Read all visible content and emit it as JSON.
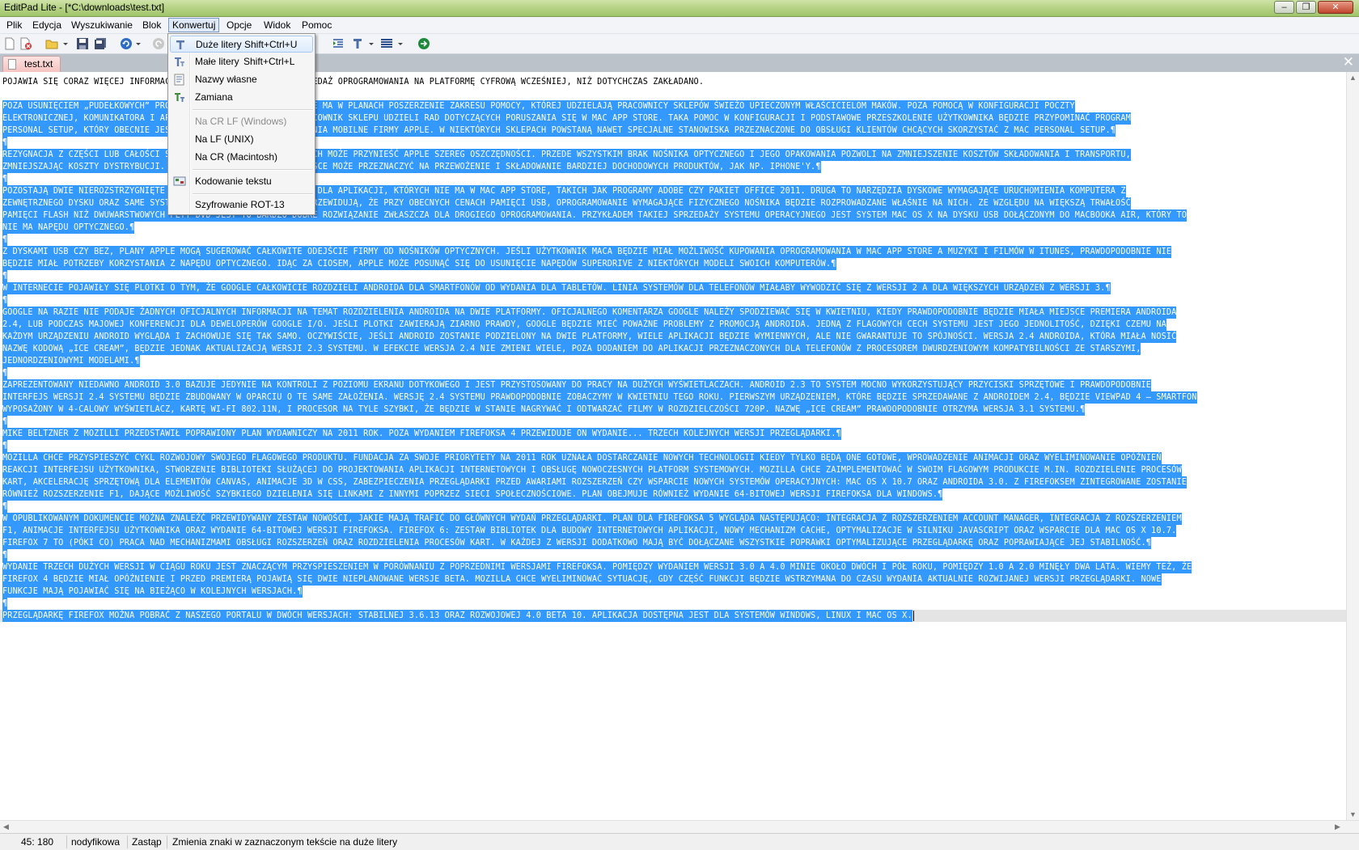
{
  "window": {
    "title": "EditPad Lite - [*C:\\downloads\\test.txt]",
    "minimize": "–",
    "restore": "❐",
    "close": "✕"
  },
  "menubar": [
    "Plik",
    "Edycja",
    "Wyszukiwanie",
    "Blok",
    "Konwertuj",
    "Opcje",
    "Widok",
    "Pomoc"
  ],
  "menubar_active": "Konwertuj",
  "toolbar_icons": [
    "new-file-icon",
    "close-file-icon",
    "open-icon",
    "save-icon",
    "save-all-icon",
    "undo-icon",
    "redo-icon",
    "indent-icon",
    "font-icon",
    "block-icon",
    "web-icon"
  ],
  "tab": {
    "label": "test.txt",
    "close": "✕"
  },
  "dropdown": {
    "items": [
      {
        "label": "Duże litery",
        "shortcut": "Shift+Ctrl+U",
        "icon": "uppercase-icon",
        "highlighted": true,
        "disabled": false
      },
      {
        "label": "Małe litery",
        "shortcut": "Shift+Ctrl+L",
        "icon": "lowercase-icon",
        "highlighted": false,
        "disabled": false
      },
      {
        "label": "Nazwy własne",
        "shortcut": "",
        "icon": "propercase-icon",
        "highlighted": false,
        "disabled": false
      },
      {
        "label": "Zamiana",
        "shortcut": "",
        "icon": "swapcase-icon",
        "highlighted": false,
        "disabled": false
      },
      {
        "label": "Na CR LF (Windows)",
        "shortcut": "",
        "icon": "",
        "highlighted": false,
        "disabled": true
      },
      {
        "label": "Na LF (UNIX)",
        "shortcut": "",
        "icon": "",
        "highlighted": false,
        "disabled": false
      },
      {
        "label": "Na CR (Macintosh)",
        "shortcut": "",
        "icon": "",
        "highlighted": false,
        "disabled": false
      },
      {
        "label": "Kodowanie tekstu",
        "shortcut": "",
        "icon": "encoding-icon",
        "highlighted": false,
        "disabled": false
      },
      {
        "label": "Szyfrowanie ROT-13",
        "shortcut": "",
        "icon": "",
        "highlighted": false,
        "disabled": false
      }
    ]
  },
  "editor": {
    "lines": [
      {
        "text": "POJAWIA SIĘ CORAZ WIĘCEJ INFORMACJI, ŻE APPLE PRZENIESIE SPRZEDAŻ OPROGRAMOWANIA NA PLATFORMĘ CYFROWĄ WCZEŚNIEJ, NIŻ DOTYCHCZAS ZAKŁADANO.",
        "sel": false,
        "pm": false
      },
      {
        "text": "",
        "sel": false,
        "pm": false
      },
      {
        "text": "POZA USUNIĘCIEM „PUDEŁKOWYCH” PROGRAMÓW Z PÓŁEK SKLEPÓW, APPLE MA W PLANACH POSZERZENIE ZAKRESU POMOCY, KTÓREJ UDZIELAJĄ PRACOWNICY SKLEPÓW ŚWIEŻO UPIECZONYM WŁAŚCICIELOM MAKÓW. POZA POMOCĄ W KONFIGURACJI POCZTY",
        "sel": true,
        "pm": false
      },
      {
        "text": "ELEKTRONICZNEJ, KOMUNIKATORA I APLIKACJI Z MAC APP STORE, PRACOWNIK SKLEPU UDZIELI RAD DOTYCZĄCYCH PORUSZANIA SIĘ W MAC APP STORE. TAKA POMOC W KONFIGURACJI I PODSTAWOWE PRZESZKOLENIE UŻYTKOWNIKA BĘDZIE PRZYPOMINAĆ PROGRAM",
        "sel": true,
        "pm": false
      },
      {
        "text": "PERSONAL SETUP, KTÓRY OBECNIE JEST DOSTĘPNY KUPUJĄCYM URZĄDZENIA MOBILNE FIRMY APPLE. W NIEKTÓRYCH SKLEPACH POWSTANĄ NAWET SPECJALNE STANOWISKA PRZEZNACZONE DO OBSŁUGI KLIENTÓW CHCĄCYCH SKORZYSTAĆ Z MAC PERSONAL SETUP.",
        "sel": true,
        "pm": true
      },
      {
        "text": "",
        "sel": true,
        "pm": true
      },
      {
        "text": "REZYGNACJA Z CZĘŚCI LUB CAŁOŚCI SPRZEDAŻY PUDEŁKOWEJ W SKLEPACH MOŻE PRZYNIEŚĆ APPLE SZEREG OSZCZĘDNOŚCI. PRZEDE WSZYSTKIM BRAK NOŚNIKA OPTYCZNEGO I JEGO OPAKOWANIA POZWOLI NA ZMNIEJSZENIE KOSZTÓW SKŁADOWANIA I TRANSPORTU,",
        "sel": true,
        "pm": false
      },
      {
        "text": "ZMNIEJSZAJĄC KOSZTY DYSTRYBUCJI. DODATKOWO ZAOSZCZĘDZONE MIEJSCE MOŻE PRZEZNACZYĆ NA PRZEWOŻENIE I SKŁADOWANIE BARDZIEJ DOCHODOWYCH PRODUKTÓW, JAK NP. IPHONE'Y.",
        "sel": true,
        "pm": true
      },
      {
        "text": "",
        "sel": true,
        "pm": true
      },
      {
        "text": "POZOSTAJĄ DWIE NIEROZSTRZYGNIĘTE KWESTIE. PIERWSZA TO MIEJSCE DLA APLIKACJI, KTÓRYCH NIE MA W MAC APP STORE, TAKICH JAK PROGRAMY ADOBE CZY PAKIET OFFICE 2011. DRUGA TO NARZĘDZIA DYSKOWE WYMAGAJĄCE URUCHOMIENIA KOMPUTERA Z",
        "sel": true,
        "pm": false
      },
      {
        "text": "ZEWNĘTRZNEGO DYSKU ORAZ SAME SYSTEMY FIRMY APPLE. ANALITYCY PRZEWIDUJĄ, ŻE PRZY OBECNYCH CENACH PAMIĘCI USB, OPROGRAMOWANIE WYMAGAJĄCE FIZYCZNEGO NOŚNIKA BĘDZIE ROZPROWADZANE WŁAŚNIE NA NICH. ZE WZGLĘDU NA WIĘKSZĄ TRWAŁOŚĆ",
        "sel": true,
        "pm": false
      },
      {
        "text": "PAMIĘCI FLASH NIŻ DWUWARSTWOWYCH PŁYT DVD JEST TO BARDZO DOBRE ROZWIĄZANIE ZWŁASZCZA DLA DROGIEGO OPROGRAMOWANIA. PRZYKŁADEM TAKIEJ SPRZEDAŻY SYSTEMU OPERACYJNEGO JEST SYSTEM MAC OS X NA DYSKU USB DOŁĄCZONYM DO MACBOOKA AIR, KTÓRY TO",
        "sel": true,
        "pm": false
      },
      {
        "text": "NIE MA NAPĘDU OPTYCZNEGO.",
        "sel": true,
        "pm": true
      },
      {
        "text": "",
        "sel": true,
        "pm": true
      },
      {
        "text": "Z DYSKAMI USB CZY BEZ, PLANY APPLE MOGĄ SUGEROWAĆ CAŁKOWITE ODEJŚCIE FIRMY OD NOŚNIKÓW OPTYCZNYCH. JEŚLI UŻYTKOWNIK MACA BĘDZIE MIAŁ MOŻLIWOŚĆ KUPOWANIA OPROGRAMOWANIA W MAC APP STORE A MUZYKI I FILMÓW W ITUNES, PRAWDOPODOBNIE NIE",
        "sel": true,
        "pm": false
      },
      {
        "text": "BĘDZIE MIAŁ POTRZEBY KORZYSTANIA Z NAPĘDU OPTYCZNEGO. IDĄC ZA CIOSEM, APPLE MOŻE POSUNĄĆ SIĘ DO USUNIĘCIE NAPĘDÓW SUPERDRIVE Z NIEKTÓRYCH MODELI SWOICH KOMPUTERÓW.",
        "sel": true,
        "pm": true
      },
      {
        "text": "",
        "sel": true,
        "pm": true
      },
      {
        "text": "W INTERNECIE POJAWIŁY SIĘ PLOTKI O TYM, ŻE GOOGLE CAŁKOWICIE ROZDZIELI ANDROIDA DLA SMARTFONÓW OD WYDANIA DLA TABLETÓW. LINIA SYSTEMÓW DLA TELEFONÓW MIAŁABY WYWODZIĆ SIĘ Z WERSJI 2 A DLA WIĘKSZYCH URZĄDZEŃ Z WERSJI 3.",
        "sel": true,
        "pm": true
      },
      {
        "text": "",
        "sel": true,
        "pm": true
      },
      {
        "text": "GOOGLE NA RAZIE NIE PODAJE ŻADNYCH OFICJALNYCH INFORMACJI NA TEMAT ROZDZIELENIA ANDROIDA NA DWIE PLATFORMY. OFICJALNEGO KOMENTARZA GOOGLE NALEŻY SPODZIEWAĆ SIĘ W KWIETNIU, KIEDY PRAWDOPODOBNIE BĘDZIE MIAŁA MIEJSCE PREMIERA ANDROIDA",
        "sel": true,
        "pm": false
      },
      {
        "text": "2.4, LUB PODCZAS MAJOWEJ KONFERENCJI DLA DEWELOPERÓW GOOGLE I/O. JEŚLI PLOTKI ZAWIERAJĄ ZIARNO PRAWDY, GOOGLE BĘDZIE MIEĆ POWAŻNE PROBLEMY Z PROMOCJĄ ANDROIDA. JEDNĄ Z FLAGOWYCH CECH SYSTEMU JEST JEGO JEDNOLITOŚĆ, DZIĘKI CZEMU NA",
        "sel": true,
        "pm": false
      },
      {
        "text": "KAŻDYM URZĄDZENIU ANDROID WYGLĄDA I ZACHOWUJE SIĘ TAK SAMO. OCZYWIŚCIE, JEŚLI ANDROID ZOSTANIE PODZIELONY NA DWIE PLATFORMY, WIELE APLIKACJI BĘDZIE WYMIENNYCH, ALE NIE GWARANTUJE TO SPÓJNOŚCI. WERSJA 2.4 ANDROIDA, KTÓRA MIAŁA NOSIĆ",
        "sel": true,
        "pm": false
      },
      {
        "text": "NAZWĘ KODOWĄ „ICE CREAM”, BĘDZIE JEDNAK AKTUALIZACJĄ WERSJI 2.3 SYSTEMU. W EFEKCIE WERSJA 2.4 NIE ZMIENI WIELE, POZA DODANIEM DO APLIKACJI PRZEZNACZONYCH DLA TELEFONÓW Z PROCESOREM DWURDZENIOWYM KOMPATYBILNOŚCI ZE STARSZYMI,",
        "sel": true,
        "pm": false
      },
      {
        "text": "JEDNORDZENIOWYMI MODELAMI.",
        "sel": true,
        "pm": true
      },
      {
        "text": "",
        "sel": true,
        "pm": true
      },
      {
        "text": "ZAPREZENTOWANY NIEDAWNO ANDROID 3.0 BAZUJE JEDYNIE NA KONTROLI Z POZIOMU EKRANU DOTYKOWEGO I JEST PRZYSTOSOWANY DO PRACY NA DUŻYCH WYŚWIETLACZACH. ANDROID 2.3 TO SYSTEM MOCNO WYKORZYSTUJĄCY PRZYCISKI SPRZĘTOWE I PRAWDOPODOBNIE",
        "sel": true,
        "pm": false
      },
      {
        "text": "INTERFEJS WERSJI 2.4 SYSTEMU BĘDZIE ZBUDOWANY W OPARCIU O TE SAME ZAŁOŻENIA. WERSJĘ 2.4 SYSTEMU PRAWDOPODOBNIE ZOBACZYMY W KWIETNIU TEGO ROKU. PIERWSZYM URZĄDZENIEM, KTÓRE BĘDZIE SPRZEDAWANE Z ANDROIDEM 2.4, BĘDZIE VIEWPAD 4 – SMARTFON",
        "sel": true,
        "pm": false
      },
      {
        "text": "WYPOSAŻONY W 4-CALOWY WYŚWIETLACZ, KARTĘ WI-FI 802.11N, I PROCESOR NA TYLE SZYBKI, ŻE BĘDZIE W STANIE NAGRYWAĆ I ODTWARZAĆ FILMY W ROZDZIELCZOŚCI 720P. NAZWĘ „ICE CREAM” PRAWDOPODOBNIE OTRZYMA WERSJA 3.1 SYSTEMU.",
        "sel": true,
        "pm": true
      },
      {
        "text": "",
        "sel": true,
        "pm": true
      },
      {
        "text": "MIKE BELTZNER Z MOZILLI PRZEDSTAWIŁ POPRAWIONY PLAN WYDAWNICZY NA 2011 ROK. POZA WYDANIEM FIREFOKSA 4 PRZEWIDUJE ON WYDANIE... TRZECH KOLEJNYCH WERSJI PRZEGLĄDARKI.",
        "sel": true,
        "pm": true
      },
      {
        "text": "",
        "sel": true,
        "pm": true
      },
      {
        "text": "MOZILLA CHCE PRZYSPIESZYĆ CYKL ROZWOJOWY SWOJEGO FLAGOWEGO PRODUKTU. FUNDACJA ZA SWOJE PRIORYTETY NA 2011 ROK UZNAŁA DOSTARCZANIE NOWYCH TECHNOLOGII KIEDY TYLKO BĘDĄ ONE GOTOWE, WPROWADZENIE ANIMACJI ORAZ WYELIMINOWANIE OPÓŹNIEŃ",
        "sel": true,
        "pm": false
      },
      {
        "text": "REAKCJI INTERFEJSU UŻYTKOWNIKA, STWORZENIE BIBLIOTEKI SŁUŻĄCEJ DO PROJEKTOWANIA APLIKACJI INTERNETOWYCH I OBSŁUGĘ NOWOCZESNYCH PLATFORM SYSTEMOWYCH. MOZILLA CHCE ZAIMPLEMENTOWAĆ W SWOIM FLAGOWYM PRODUKCIE M.IN. ROZDZIELENIE PROCESÓW",
        "sel": true,
        "pm": false
      },
      {
        "text": "KART, AKCELERACJĘ SPRZĘTOWĄ DLA ELEMENTÓW CANVAS, ANIMACJE 3D W CSS, ZABEZPIECZENIA PRZEGLĄDARKI PRZED AWARIAMI ROZSZERZEŃ CZY WSPARCIE NOWYCH SYSTEMÓW OPERACYJNYCH: MAC OS X 10.7 ORAZ ANDROIDA 3.0. Z FIREFOKSEM ZINTEGROWANE ZOSTANIE",
        "sel": true,
        "pm": false
      },
      {
        "text": "RÓWNIEŻ ROZSZERZENIE F1, DAJĄCE MOŻLIWOŚĆ SZYBKIEGO DZIELENIA SIĘ LINKAMI Z INNYMI POPRZEZ SIECI SPOŁECZNOŚCIOWE. PLAN OBEJMUJE RÓWNIEŻ WYDANIE 64-BITOWEJ WERSJI FIREFOKSA DLA WINDOWS.",
        "sel": true,
        "pm": true
      },
      {
        "text": "",
        "sel": true,
        "pm": true
      },
      {
        "text": "W OPUBLIKOWANYM DOKUMENCIE MOŻNA ZNALEŹĆ PRZEWIDYWANY ZESTAW NOWOŚCI, JAKIE MAJĄ TRAFIĆ DO GŁÓWNYCH WYDAŃ PRZEGLĄDARKI. PLAN DLA FIREFOKSA 5 WYGLĄDA NASTĘPUJĄCO: INTEGRACJA Z ROZSZERZENIEM ACCOUNT MANAGER, INTEGRACJA Z ROZSZERZENIEM",
        "sel": true,
        "pm": false
      },
      {
        "text": "F1, ANIMACJE INTERFEJSU UŻYTKOWNIKA ORAZ WYDANIE 64-BITOWEJ WERSJI FIREFOKSA. FIREFOX 6: ZESTAW BIBLIOTEK DLA BUDOWY INTERNETOWYCH APLIKACJI, NOWY MECHANIZM CACHE, OPTYMALIZACJE W SILNIKU JAVASCRIPT ORAZ WSPARCIE DLA MAC OS X 10.7.",
        "sel": true,
        "pm": false
      },
      {
        "text": "FIREFOX 7 TO (PÓKI CO) PRACA NAD MECHANIZMAMI OBSŁUGI ROZSZERZEŃ ORAZ ROZDZIELENIA PROCESÓW KART. W KAŻDEJ Z WERSJI DODATKOWO MAJĄ BYĆ DOŁĄCZANE WSZYSTKIE POPRAWKI OPTYMALIZUJĄCE PRZEGLĄDARKĘ ORAZ POPRAWIAJĄCE JEJ STABILNOŚĆ.",
        "sel": true,
        "pm": true
      },
      {
        "text": "",
        "sel": true,
        "pm": true
      },
      {
        "text": "WYDANIE TRZECH DUŻYCH WERSJI W CIĄGU ROKU JEST ZNACZĄCYM PRZYSPIESZENIEM W PORÓWNANIU Z POPRZEDNIMI WERSJAMI FIREFOKSA. POMIĘDZY WYDANIEM WERSJI 3.0 A 4.0 MINIE OKOŁO DWÓCH I PÓŁ ROKU, POMIĘDZY 1.0 A 2.0 MINĘŁY DWA LATA. WIEMY TEŻ, ŻE",
        "sel": true,
        "pm": false
      },
      {
        "text": "FIREFOX 4 BĘDZIE MIAŁ OPÓŹNIENIE I PRZED PREMIERĄ POJAWIĄ SIĘ DWIE NIEPLANOWANE WERSJE BETA. MOZILLA CHCE WYELIMINOWAĆ SYTUACJĘ, GDY CZĘŚĆ FUNKCJI BĘDZIE WSTRZYMANA DO CZASU WYDANIA AKTUALNIE ROZWIJANEJ WERSJI PRZEGLĄDARKI. NOWE",
        "sel": true,
        "pm": false
      },
      {
        "text": "FUNKCJE MAJĄ POJAWIAĆ SIĘ NA BIEŻĄCO W KOLEJNYCH WERSJACH.",
        "sel": true,
        "pm": true
      },
      {
        "text": "",
        "sel": true,
        "pm": true
      },
      {
        "text": "PRZEGLĄDARKĘ FIREFOX MOŻNA POBRAĆ Z NASZEGO PORTALU W DWÓCH WERSJACH: STABILNEJ 3.6.13 ORAZ ROZWOJOWEJ 4.0 BETA 10. APLIKACJA DOSTĘPNA JEST DLA SYSTEMÓW WINDOWS, LINUX I MAC OS X.",
        "sel": true,
        "pm": false
      }
    ]
  },
  "statusbar": {
    "position": "45: 180",
    "mode": "nodyfikowa",
    "overwrite": "Zastąp",
    "hint": "Zmienia znaki w zaznaczonym tekście na duże litery"
  }
}
